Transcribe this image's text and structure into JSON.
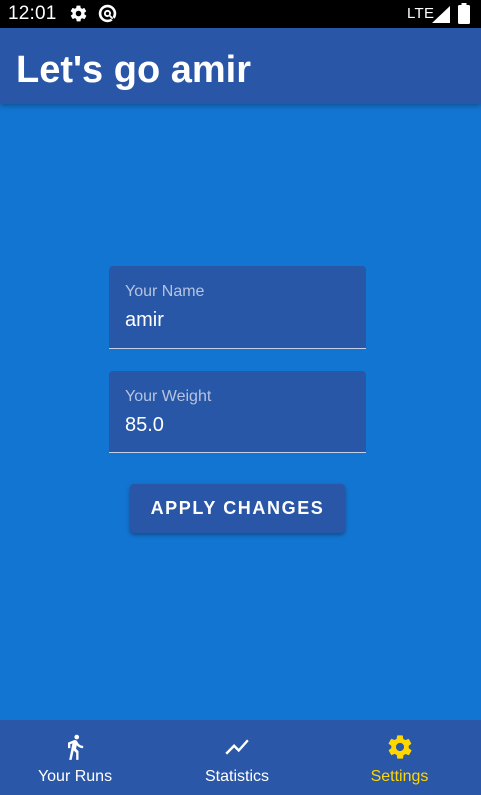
{
  "status_bar": {
    "time": "12:01",
    "network": "LTE",
    "icons": [
      "settings-icon",
      "data-saver-icon",
      "signal-icon",
      "battery-icon"
    ]
  },
  "app_bar": {
    "title": "Let's go amir"
  },
  "form": {
    "name_field": {
      "label": "Your Name",
      "value": "amir"
    },
    "weight_field": {
      "label": "Your Weight",
      "value": "85.0"
    },
    "apply_label": "APPLY CHANGES"
  },
  "bottom_nav": {
    "items": [
      {
        "label": "Your Runs",
        "icon": "run-icon",
        "selected": false
      },
      {
        "label": "Statistics",
        "icon": "trending-up-icon",
        "selected": false
      },
      {
        "label": "Settings",
        "icon": "gear-icon",
        "selected": true
      }
    ],
    "selected_color": "#ffd600",
    "unselected_color": "#ffffff"
  },
  "colors": {
    "background": "#1375d2",
    "primary": "#2956a7",
    "status_bar": "#000000",
    "text": "#ffffff"
  }
}
